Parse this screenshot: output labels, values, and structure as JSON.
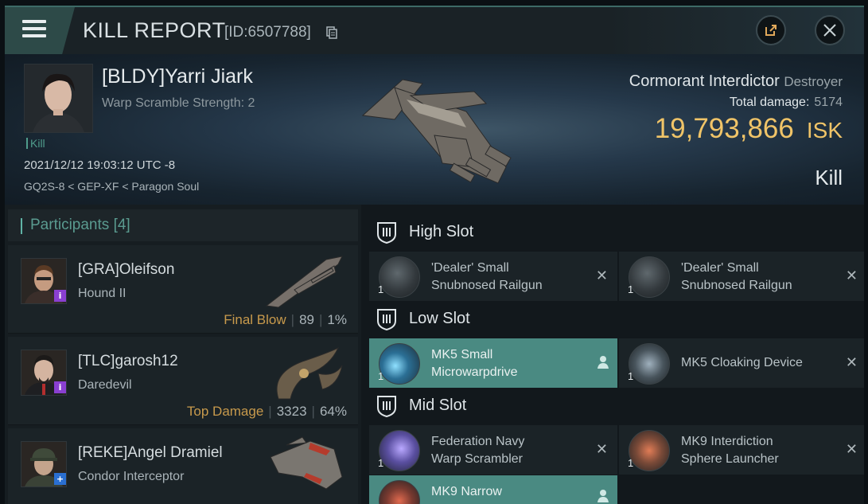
{
  "header": {
    "title": "KILL REPORT",
    "report_id": "[ID:6507788]"
  },
  "victim": {
    "name": "[BLDY]Yarri Jiark",
    "warp_scramble": "Warp Scramble Strength: 2",
    "tag": "Kill",
    "datetime": "2021/12/12 19:03:12 UTC -8",
    "location": "GQ2S-8 < GEP-XF < Paragon Soul",
    "ship": "Cormorant Interdictor",
    "ship_class": "Destroyer",
    "total_damage_label": "Total damage:",
    "total_damage": "5174",
    "isk_value": "19,793,866",
    "isk_unit": "ISK",
    "result": "Kill"
  },
  "participants": {
    "label": "Participants",
    "count": "[4]",
    "rows": [
      {
        "name": "[GRA]Oleifson",
        "ship": "Hound II",
        "stat_label": "Final Blow",
        "damage": "89",
        "percent": "1%",
        "badge": "i",
        "badge_color": "#8a3fd1"
      },
      {
        "name": "[TLC]garosh12",
        "ship": "Daredevil",
        "stat_label": "Top Damage",
        "damage": "3323",
        "percent": "64%",
        "badge": "i",
        "badge_color": "#8a3fd1"
      },
      {
        "name": "[REKE]Angel Dramiel",
        "ship": "Condor Interceptor",
        "badge": "+",
        "badge_color": "#2a6fd1"
      }
    ]
  },
  "fitting": {
    "high_slot": {
      "label": "High Slot",
      "items": [
        {
          "name_line1": "'Dealer' Small",
          "name_line2": "Snubnosed Railgun",
          "qty": "1"
        },
        {
          "name_line1": "'Dealer' Small",
          "name_line2": "Snubnosed Railgun",
          "qty": "1"
        }
      ]
    },
    "low_slot": {
      "label": "Low Slot",
      "items": [
        {
          "name_line1": "MK5 Small",
          "name_line2": "Microwarpdrive",
          "qty": "1"
        },
        {
          "name_line1": "MK5 Cloaking Device",
          "qty": "1"
        }
      ]
    },
    "mid_slot": {
      "label": "Mid Slot",
      "items": [
        {
          "name_line1": "Federation Navy",
          "name_line2": "Warp Scrambler",
          "qty": "1"
        },
        {
          "name_line1": "MK9 Interdiction",
          "name_line2": "Sphere Launcher",
          "qty": "1"
        },
        {
          "name_line1": "MK9 Narrow"
        }
      ]
    }
  },
  "colors": {
    "accent": "#4a8a82",
    "isk": "#f0c468",
    "stat_label": "#c89a4c"
  }
}
